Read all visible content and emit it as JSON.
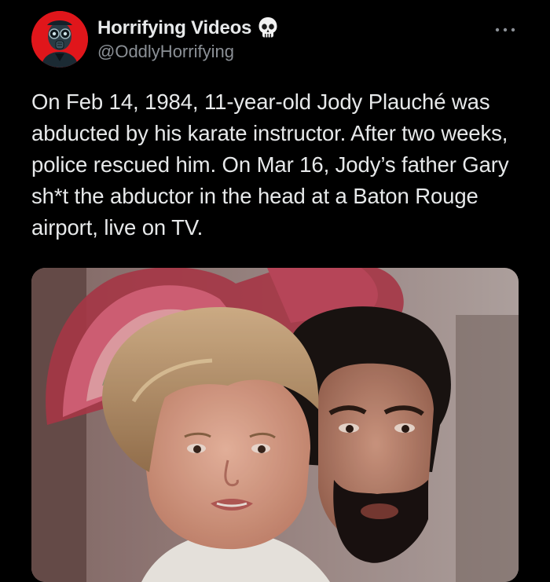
{
  "tweet": {
    "author": {
      "display_name": "Horrifying Videos",
      "handle": "@OddlyHorrifying",
      "badge_icon": "skull-icon",
      "avatar_bg": "#e0161b"
    },
    "text": "On Feb 14, 1984, 11-year-old Jody Plauché was abducted by his karate instructor. After two weeks, police rescued him. On Mar 16, Jody’s father Gary sh*t the abductor in the head at a Baton Rouge airport, live on TV.",
    "more_icon": "more-horizontal-icon",
    "media": {
      "type": "photo"
    }
  },
  "colors": {
    "background": "#000000",
    "text_primary": "#e7e9ea",
    "text_secondary": "#8b9096"
  }
}
